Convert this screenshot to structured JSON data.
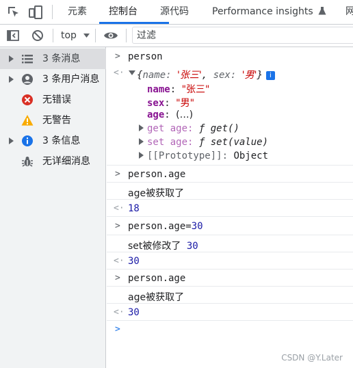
{
  "tabs": [
    {
      "label": "元素"
    },
    {
      "label": "控制台"
    },
    {
      "label": "源代码"
    },
    {
      "label": "Performance insights"
    },
    {
      "label": "网"
    }
  ],
  "toolbar": {
    "context": "top",
    "filter_placeholder": "过滤"
  },
  "sidebar": {
    "items": [
      {
        "label": "3 条消息",
        "icon": "list-icon",
        "expandable": true,
        "selected": true
      },
      {
        "label": "3 条用户消息",
        "icon": "user-icon",
        "expandable": true
      },
      {
        "label": "无错误",
        "icon": "error-icon",
        "expandable": false
      },
      {
        "label": "无警告",
        "icon": "warning-icon",
        "expandable": false
      },
      {
        "label": "3 条信息",
        "icon": "info-icon",
        "expandable": true
      },
      {
        "label": "无详细消息",
        "icon": "bug-icon",
        "expandable": false
      }
    ]
  },
  "console": {
    "r1_input": "person",
    "obj_open": "{",
    "obj_k1": "name",
    "obj_v1": "'张三'",
    "obj_k2": "sex",
    "obj_v2": "'男'",
    "obj_close": "}",
    "obj_info": "i",
    "p1_key": "name",
    "p1_val": "\"张三\"",
    "p2_key": "sex",
    "p2_val": "\"男\"",
    "p3_key": "age",
    "p3_val": "(…)",
    "get_label": "get age:",
    "get_fn": "ƒ get()",
    "set_label": "set age:",
    "set_fn": "ƒ set(value)",
    "proto_key": "[[Prototype]]:",
    "proto_val": "Object",
    "r2_input": "person.age",
    "r2_log": "age被获取了",
    "r2_result": "18",
    "r3_input_a": "person.age=",
    "r3_input_b": "30",
    "r3_log": "set被修改了",
    "r3_log_num": "30",
    "r3_result": "30",
    "r4_input": "person.age",
    "r4_log": "age被获取了",
    "r4_result": "30"
  },
  "watermark": "CSDN @Y.Later",
  "colors": {
    "accent": "#1a73e8",
    "number": "#1a1aa6",
    "property": "#881391",
    "string": "#c80000",
    "error": "#d93025",
    "warning": "#f9ab00"
  }
}
